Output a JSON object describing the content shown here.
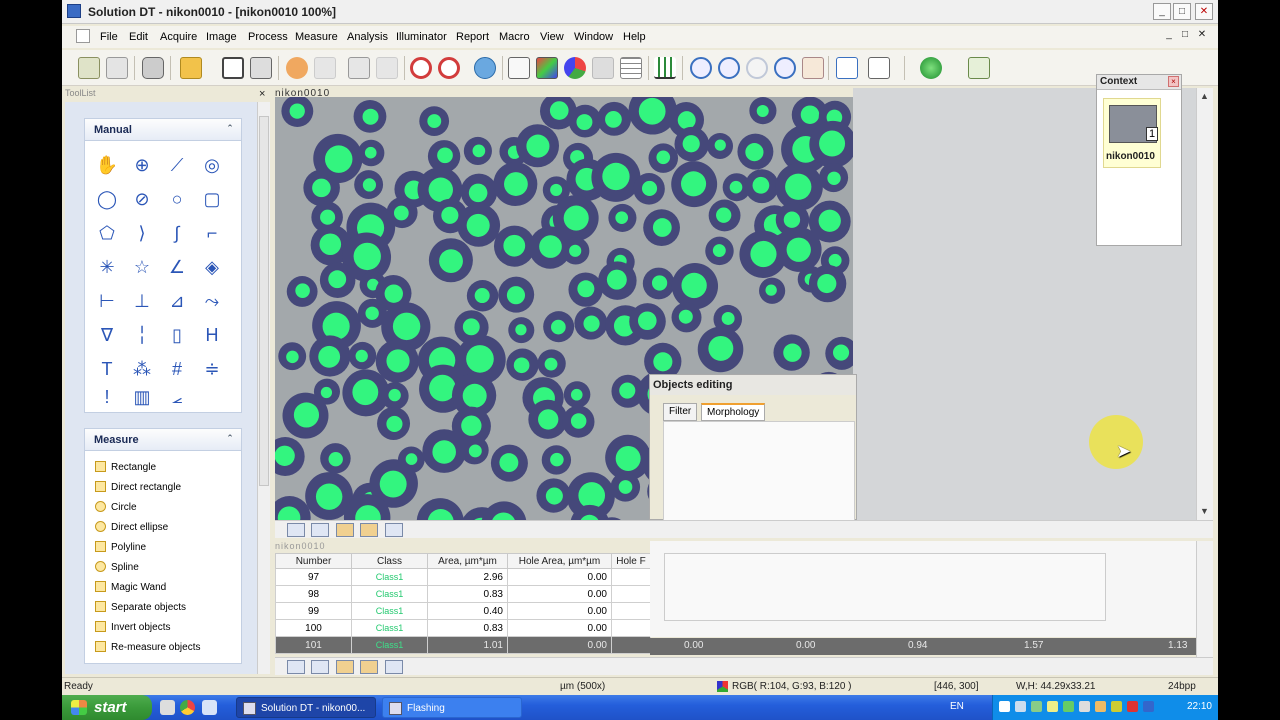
{
  "window": {
    "title": "Solution DT - nikon0010 - [nikon0010 100%]",
    "minimize": "_",
    "maximize": "□",
    "close": "✕"
  },
  "menu": {
    "items": [
      "File",
      "Edit",
      "Acquire",
      "Image",
      "Process",
      "Measure",
      "Analysis",
      "Illuminator",
      "Report",
      "Macro",
      "View",
      "Window",
      "Help"
    ]
  },
  "toollist": {
    "header": "ToolList",
    "close": "×",
    "manual_group": {
      "title": "Manual",
      "collapse": "⌃"
    },
    "measure_group": {
      "title": "Measure",
      "collapse": "⌃",
      "items": [
        {
          "label": "Rectangle",
          "icon": "rectangle-icon"
        },
        {
          "label": "Direct rectangle",
          "icon": "direct-rectangle-icon"
        },
        {
          "label": "Circle",
          "icon": "circle-icon"
        },
        {
          "label": "Direct ellipse",
          "icon": "direct-ellipse-icon"
        },
        {
          "label": "Polyline",
          "icon": "polyline-icon"
        },
        {
          "label": "Spline",
          "icon": "spline-icon"
        },
        {
          "label": "Magic Wand",
          "icon": "magic-wand-icon"
        },
        {
          "label": "Separate objects",
          "icon": "separate-objects-icon"
        },
        {
          "label": "Invert objects",
          "icon": "invert-objects-icon"
        },
        {
          "label": "Re-measure objects",
          "icon": "re-measure-objects-icon"
        }
      ]
    }
  },
  "image": {
    "title": "nikon0010"
  },
  "context": {
    "title": "Context",
    "close": "×",
    "thumb_number": "1",
    "thumb_name": "nikon0010"
  },
  "objects_editing": {
    "title": "Objects editing",
    "tabs": [
      "Filter",
      "Morphology"
    ],
    "active_tab": "Morphology"
  },
  "table": {
    "title": "nikon0010",
    "columns": [
      "Number",
      "Class",
      "Area, µm*µm",
      "Hole Area, µm*µm",
      "Hole F"
    ],
    "rows": [
      {
        "number": "97",
        "class": "Class1",
        "area": "2.96",
        "hole_area": "0.00"
      },
      {
        "number": "98",
        "class": "Class1",
        "area": "0.83",
        "hole_area": "0.00"
      },
      {
        "number": "99",
        "class": "Class1",
        "area": "0.40",
        "hole_area": "0.00"
      },
      {
        "number": "100",
        "class": "Class1",
        "area": "0.83",
        "hole_area": "0.00"
      },
      {
        "number": "101",
        "class": "Class1",
        "area": "1.01",
        "hole_area": "0.00"
      }
    ],
    "selected_row_extra": [
      "0.00",
      "0.00",
      "0.94",
      "1.57",
      "1.13"
    ]
  },
  "status": {
    "ready": "Ready",
    "scale": "µm (500x)",
    "rgb": "RGB( R:104, G:93, B:120 )",
    "position": "[446, 300]",
    "wh": "W,H: 44.29x33.21",
    "bpp": "24bpp"
  },
  "taskbar": {
    "start": "start",
    "tasks": [
      "Solution DT - nikon00...",
      "Flashing"
    ],
    "language": "EN",
    "clock": "22:10"
  },
  "colors": {
    "object_fill": "#33f57f",
    "object_ring": "#45487a",
    "image_bg": "#a3a8ab",
    "accent": "#2b56b7"
  }
}
